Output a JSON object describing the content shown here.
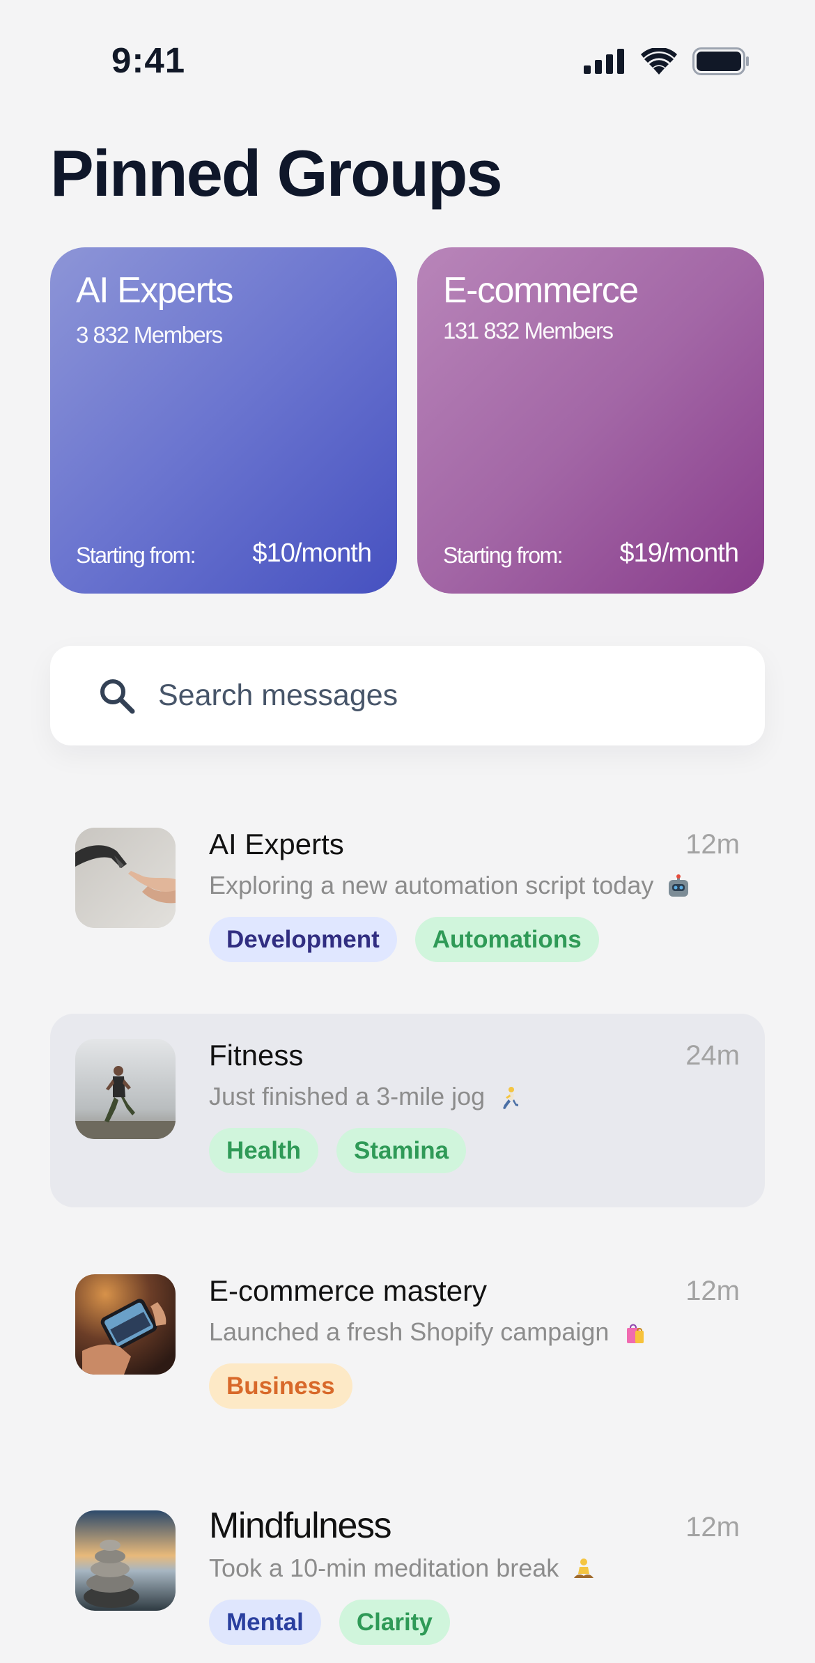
{
  "status_bar": {
    "time": "9:41"
  },
  "page_title": "Pinned Groups",
  "pinned_groups": [
    {
      "title": "AI Experts",
      "members": "3 832 Members",
      "starting_label": "Starting from:",
      "price": "$10/month",
      "color": "#5b64c8"
    },
    {
      "title": "E-commerce",
      "members": "131 832 Members",
      "starting_label": "Starting from:",
      "price": "$19/month",
      "color": "#9a5a9e"
    }
  ],
  "search": {
    "placeholder": "Search messages",
    "value": ""
  },
  "chats": [
    {
      "name": "AI Experts",
      "time": "12m",
      "message": "Exploring a new automation script today",
      "emoji_icon": "robot-icon",
      "tags": [
        "Development",
        "Automations"
      ],
      "selected": false
    },
    {
      "name": "Fitness",
      "time": "24m",
      "message": "Just finished a 3-mile jog",
      "emoji_icon": "runner-icon",
      "tags": [
        "Health",
        "Stamina"
      ],
      "selected": true
    },
    {
      "name": "E-commerce mastery",
      "time": "12m",
      "message": "Launched a fresh Shopify campaign",
      "emoji_icon": "shopping-bags-icon",
      "tags": [
        "Business"
      ],
      "selected": false
    },
    {
      "name": "Mindfulness",
      "time": "12m",
      "message": "Took a 10-min meditation break",
      "emoji_icon": "meditation-icon",
      "tags": [
        "Mental",
        "Clarity"
      ],
      "selected": false
    }
  ],
  "colors": {
    "background": "#f4f4f5",
    "title": "#0f172a",
    "selected_row": "#e8e9ee",
    "tag_indigo_bg": "#e0e7ff",
    "tag_green_bg": "#d0f5dc",
    "tag_amber_bg": "#fde9c6"
  }
}
